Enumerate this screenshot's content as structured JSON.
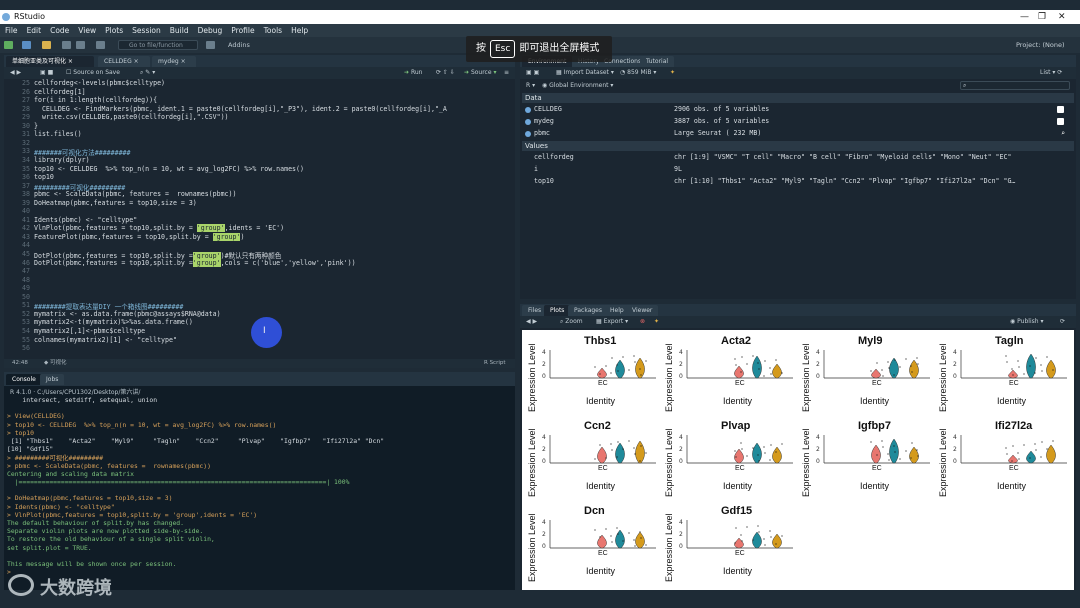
{
  "window": {
    "title": "RStudio",
    "project": "Project: (None)"
  },
  "menu": [
    "File",
    "Edit",
    "Code",
    "View",
    "Plots",
    "Session",
    "Build",
    "Debug",
    "Profile",
    "Tools",
    "Help"
  ],
  "toolbar": {
    "goto": "Go to file/function",
    "addins": "Addins"
  },
  "esc_banner": {
    "prefix": "按",
    "key": "Esc",
    "suffix": "即可退出全屏模式"
  },
  "source": {
    "tabs": [
      "单细胞亚类及可视化",
      "CELLDEG",
      "mydeg"
    ],
    "source_on_save": "Source on Save",
    "run": "Run",
    "source_btn": "Source",
    "lines": [
      {
        "n": "25",
        "t": "cellfordeg<-levels(pbmc$celltype)"
      },
      {
        "n": "26",
        "t": "cellfordeg[1]"
      },
      {
        "n": "27",
        "t": "for(i in 1:length(cellfordeg)){"
      },
      {
        "n": "28",
        "t": "  CELLDEG <- FindMarkers(pbmc, ident.1 = paste0(cellfordeg[i],\"_P3\"), ident.2 = paste0(cellfordeg[i],\"_A"
      },
      {
        "n": "29",
        "t": "  write.csv(CELLDEG,paste0(cellfordeg[i],\".CSV\"))"
      },
      {
        "n": "30",
        "t": "}"
      },
      {
        "n": "31",
        "t": "list.files()"
      },
      {
        "n": "32",
        "t": ""
      },
      {
        "n": "33",
        "t": "#######可视化方法#########"
      },
      {
        "n": "34",
        "t": "library(dplyr)"
      },
      {
        "n": "35",
        "t": "top10 <- CELLDEG  %>% top_n(n = 10, wt = avg_log2FC) %>% row.names()"
      },
      {
        "n": "36",
        "t": "top10"
      },
      {
        "n": "37",
        "t": "#########可视化#########"
      },
      {
        "n": "38",
        "t": "pbmc <- ScaleData(pbmc, features =  rownames(pbmc))"
      },
      {
        "n": "39",
        "t": "DoHeatmap(pbmc,features = top10,size = 3)"
      },
      {
        "n": "40",
        "t": ""
      },
      {
        "n": "41",
        "t": "Idents(pbmc) <- \"celltype\""
      },
      {
        "n": "42",
        "t": "VlnPlot(pbmc,features = top10,split.by = 'group',idents = 'EC')"
      },
      {
        "n": "43",
        "t": "FeaturePlot(pbmc,features = top10,split.by = 'group')"
      },
      {
        "n": "44",
        "t": ""
      },
      {
        "n": "45",
        "t": "DotPlot(pbmc,features = top10,split.by ='group')#默认只有两种颜色"
      },
      {
        "n": "46",
        "t": "DotPlot(pbmc,features = top10,split.by ='group',cols = c('blue','yellow','pink'))"
      },
      {
        "n": "47",
        "t": ""
      },
      {
        "n": "48",
        "t": ""
      },
      {
        "n": "49",
        "t": ""
      },
      {
        "n": "50",
        "t": ""
      },
      {
        "n": "51",
        "t": "########提取表达量DIY 一个箱线图#########"
      },
      {
        "n": "52",
        "t": "mymatrix <- as.data.frame(pbmc@assays$RNA@data)"
      },
      {
        "n": "53",
        "t": "mymatrix2<-t(mymatrix)%>%as.data.frame()"
      },
      {
        "n": "54",
        "t": "mymatrix2[,1]<-pbmc$celltype"
      },
      {
        "n": "55",
        "t": "colnames(mymatrix2)[1] <- \"celltype\""
      },
      {
        "n": "56",
        "t": ""
      }
    ],
    "status_pos": "42:48",
    "status_section": "可视化",
    "status_type": "R Script"
  },
  "console": {
    "tabs": [
      "Console",
      "Jobs"
    ],
    "path": "R 4.1.0 · C:/Users/CPU1302/Desktop/第六讲/",
    "lines": [
      {
        "c": "cw",
        "t": "    intersect, setdiff, setequal, union"
      },
      {
        "c": "cw",
        "t": ""
      },
      {
        "c": "cp",
        "t": "> View(CELLDEG)"
      },
      {
        "c": "cp",
        "t": "> top10 <- CELLDEG  %>% top_n(n = 10, wt = avg_log2FC) %>% row.names()"
      },
      {
        "c": "cp",
        "t": "> top10"
      },
      {
        "c": "cw",
        "t": " [1] \"Thbs1\"    \"Acta2\"    \"Myl9\"     \"Tagln\"    \"Ccn2\"     \"Plvap\"    \"Igfbp7\"   \"Ifi27l2a\" \"Dcn\""
      },
      {
        "c": "cw",
        "t": "[10] \"Gdf15\""
      },
      {
        "c": "cp",
        "t": "> #########可视化#########"
      },
      {
        "c": "cp",
        "t": "> pbmc <- ScaleData(pbmc, features =  rownames(pbmc))"
      },
      {
        "c": "cg",
        "t": "Centering and scaling data matrix"
      },
      {
        "c": "cg",
        "t": "  |================================================================================| 100%"
      },
      {
        "c": "cw",
        "t": ""
      },
      {
        "c": "cp",
        "t": "> DoHeatmap(pbmc,features = top10,size = 3)"
      },
      {
        "c": "cp",
        "t": "> Idents(pbmc) <- \"celltype\""
      },
      {
        "c": "cp",
        "t": "> VlnPlot(pbmc,features = top10,split.by = 'group',idents = 'EC')"
      },
      {
        "c": "cg",
        "t": "The default behaviour of split.by has changed."
      },
      {
        "c": "cg",
        "t": "Separate violin plots are now plotted side-by-side."
      },
      {
        "c": "cg",
        "t": "To restore the old behaviour of a single split violin,"
      },
      {
        "c": "cg",
        "t": "set split.plot = TRUE."
      },
      {
        "c": "cw",
        "t": ""
      },
      {
        "c": "cg",
        "t": "This message will be shown once per session."
      },
      {
        "c": "cp",
        "t": ">"
      }
    ]
  },
  "watermark": "大数跨境",
  "environment": {
    "tabs": [
      "Environment",
      "History",
      "Connections",
      "Tutorial"
    ],
    "import": "Import Dataset",
    "memory": "859 MiB",
    "list": "List",
    "scope": "Global Environment",
    "data_header": "Data",
    "data": [
      {
        "name": "CELLDEG",
        "value": "2906 obs. of 5 variables"
      },
      {
        "name": "mydeg",
        "value": "3887 obs. of 5 variables"
      },
      {
        "name": "pbmc",
        "value": "Large Seurat ( 232 MB)"
      }
    ],
    "values_header": "Values",
    "values": [
      {
        "name": "cellfordeg",
        "value": "chr [1:9] \"VSMC\" \"T cell\" \"Macro\" \"B cell\" \"Fibro\" \"Myeloid cells\" \"Mono\" \"Neut\" \"EC\""
      },
      {
        "name": "i",
        "value": "9L"
      },
      {
        "name": "top10",
        "value": "chr [1:10] \"Thbs1\" \"Acta2\" \"Myl9\" \"Tagln\" \"Ccn2\" \"Plvap\" \"Igfbp7\" \"Ifi27l2a\" \"Dcn\" \"G…"
      }
    ]
  },
  "plots": {
    "tabs": [
      "Files",
      "Plots",
      "Packages",
      "Help",
      "Viewer"
    ],
    "zoom": "Zoom",
    "export": "Export",
    "publish": "Publish",
    "ylabel": "Expression Level",
    "xlabel": "Identity",
    "xtick": "EC",
    "panels": [
      "Thbs1",
      "Acta2",
      "Myl9",
      "Tagln",
      "Ccn2",
      "Plvap",
      "Igfbp7",
      "Ifi27l2a",
      "Dcn",
      "Gdf15"
    ],
    "colors": {
      "a": "#e8766f",
      "b": "#1f8a9a",
      "c": "#d49a1c"
    }
  }
}
